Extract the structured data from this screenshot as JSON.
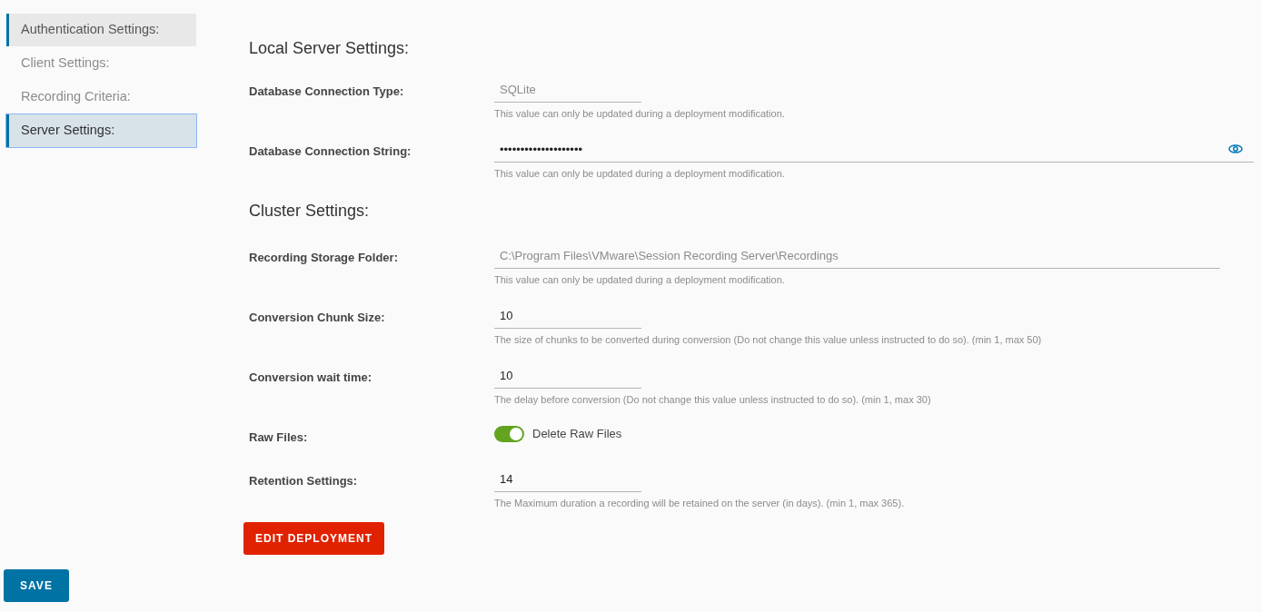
{
  "sidebar": {
    "items": [
      {
        "label": "Authentication Settings:",
        "selected": false,
        "hovered": true
      },
      {
        "label": "Client Settings:",
        "selected": false,
        "hovered": false
      },
      {
        "label": "Recording Criteria:",
        "selected": false,
        "hovered": false
      },
      {
        "label": "Server Settings:",
        "selected": true,
        "hovered": false
      }
    ]
  },
  "sections": [
    {
      "title": "Local Server Settings:",
      "fields": [
        {
          "kind": "text",
          "label": "Database Connection Type:",
          "value": "SQLite",
          "readonly": true,
          "wide": false,
          "hint": "This value can only be updated during a deployment modification."
        },
        {
          "kind": "password",
          "label": "Database Connection String:",
          "value": "••••••••••••••••••••",
          "readonly": false,
          "wide": true,
          "hint": "This value can only be updated during a deployment modification."
        }
      ]
    },
    {
      "title": "Cluster Settings:",
      "fields": [
        {
          "kind": "text",
          "label": "Recording Storage Folder:",
          "value": "C:\\Program Files\\VMware\\Session Recording Server\\Recordings",
          "readonly": true,
          "wide": true,
          "hint": "This value can only be updated during a deployment modification."
        },
        {
          "kind": "text",
          "label": "Conversion Chunk Size:",
          "value": "10",
          "readonly": false,
          "wide": false,
          "hint": "The size of chunks to be converted during conversion (Do not change this value unless instructed to do so). (min 1, max 50)"
        },
        {
          "kind": "text",
          "label": "Conversion wait time:",
          "value": "10",
          "readonly": false,
          "wide": false,
          "hint": "The delay before conversion (Do not change this value unless instructed to do so). (min 1, max 30)"
        },
        {
          "kind": "toggle",
          "label": "Raw Files:",
          "toggle_label": "Delete Raw Files",
          "on": true
        },
        {
          "kind": "text",
          "label": "Retention Settings:",
          "value": "14",
          "readonly": false,
          "wide": false,
          "hint": "The Maximum duration a recording will be retained on the server (in days). (min 1, max 365)."
        }
      ]
    }
  ],
  "edit_button": "EDIT DEPLOYMENT",
  "save_button": "SAVE"
}
